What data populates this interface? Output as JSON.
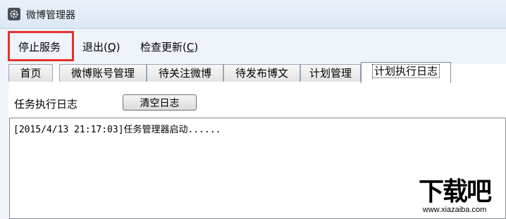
{
  "window": {
    "title": "微博管理器",
    "icon": "gear-icon"
  },
  "menu": {
    "items": [
      {
        "label": "停止服务",
        "highlighted": true
      },
      {
        "label": "退出(",
        "accel": "Q",
        "suffix": ")"
      },
      {
        "label": "检查更新(",
        "accel": "C",
        "suffix": ")"
      }
    ]
  },
  "tabs": [
    {
      "label": "首页"
    },
    {
      "label": "微博账号管理"
    },
    {
      "label": "待关注微博"
    },
    {
      "label": "待发布博文"
    },
    {
      "label": "计划管理"
    },
    {
      "label": "计划执行日志",
      "active": true
    }
  ],
  "log_panel": {
    "label": "任务执行日志",
    "clear_button": "清空日志",
    "entries": [
      "[2015/4/13 21:17:03]任务管理器启动......"
    ]
  },
  "watermark": {
    "brand": "下载吧",
    "url": "www.xiazaiba.com"
  },
  "colors": {
    "highlight_border": "#e5312d",
    "menubar_bg": "#eff4fb",
    "titlebar_bg": "#dde8f5"
  }
}
